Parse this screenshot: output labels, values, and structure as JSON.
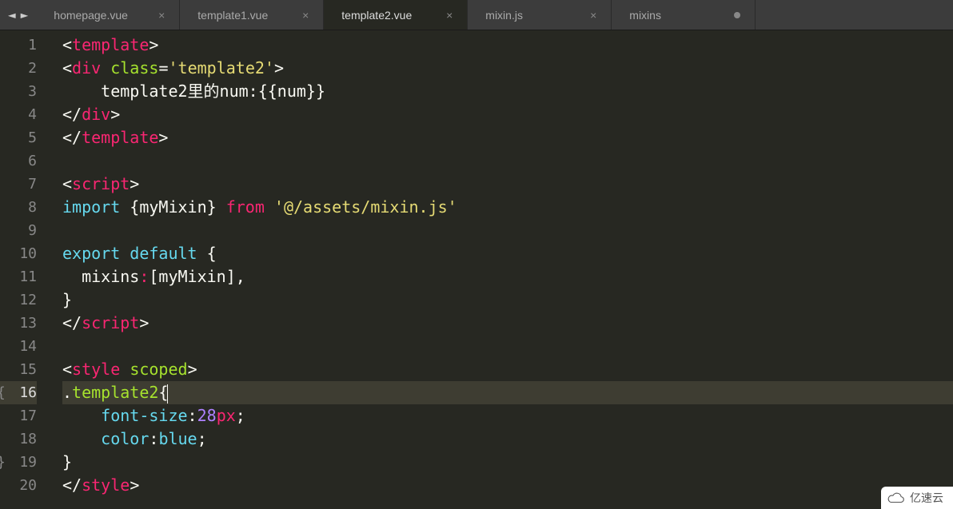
{
  "nav": {
    "back": "◄",
    "forward": "►"
  },
  "tabs": [
    {
      "label": "homepage.vue",
      "active": false,
      "closable": true
    },
    {
      "label": "template1.vue",
      "active": false,
      "closable": true
    },
    {
      "label": "template2.vue",
      "active": true,
      "closable": true
    },
    {
      "label": "mixin.js",
      "active": false,
      "closable": true
    },
    {
      "label": "mixins",
      "active": false,
      "closable": false,
      "dirty": true
    }
  ],
  "active_line": 16,
  "fold_open": 16,
  "fold_close": 19,
  "code": [
    {
      "n": 1,
      "t": [
        [
          "<",
          "c-white"
        ],
        [
          "template",
          "c-red"
        ],
        [
          ">",
          "c-white"
        ]
      ]
    },
    {
      "n": 2,
      "t": [
        [
          "<",
          "c-white"
        ],
        [
          "div",
          "c-red"
        ],
        [
          " ",
          "c-white"
        ],
        [
          "class",
          "c-green"
        ],
        [
          "=",
          "c-white"
        ],
        [
          "'template2'",
          "c-yellow"
        ],
        [
          ">",
          "c-white"
        ]
      ]
    },
    {
      "n": 3,
      "t": [
        [
          "    template2里的num:{{num}}",
          "c-white"
        ]
      ]
    },
    {
      "n": 4,
      "t": [
        [
          "</",
          "c-white"
        ],
        [
          "div",
          "c-red"
        ],
        [
          ">",
          "c-white"
        ]
      ]
    },
    {
      "n": 5,
      "t": [
        [
          "</",
          "c-white"
        ],
        [
          "template",
          "c-red"
        ],
        [
          ">",
          "c-white"
        ]
      ]
    },
    {
      "n": 6,
      "t": []
    },
    {
      "n": 7,
      "t": [
        [
          "<",
          "c-white"
        ],
        [
          "script",
          "c-red"
        ],
        [
          ">",
          "c-white"
        ]
      ]
    },
    {
      "n": 8,
      "t": [
        [
          "import",
          "c-blue"
        ],
        [
          " {myMixin} ",
          "c-white"
        ],
        [
          "from",
          "c-red"
        ],
        [
          " ",
          "c-white"
        ],
        [
          "'@/assets/mixin.js'",
          "c-yellow"
        ]
      ]
    },
    {
      "n": 9,
      "t": []
    },
    {
      "n": 10,
      "t": [
        [
          "export",
          "c-blue"
        ],
        [
          " ",
          "c-white"
        ],
        [
          "default",
          "c-blue"
        ],
        [
          " {",
          "c-white"
        ]
      ]
    },
    {
      "n": 11,
      "t": [
        [
          "  mixins",
          "c-white"
        ],
        [
          ":",
          "c-red"
        ],
        [
          "[myMixin],",
          "c-white"
        ]
      ]
    },
    {
      "n": 12,
      "t": [
        [
          "}",
          "c-white"
        ]
      ]
    },
    {
      "n": 13,
      "t": [
        [
          "</",
          "c-white"
        ],
        [
          "script",
          "c-red"
        ],
        [
          ">",
          "c-white"
        ]
      ]
    },
    {
      "n": 14,
      "t": []
    },
    {
      "n": 15,
      "t": [
        [
          "<",
          "c-white"
        ],
        [
          "style",
          "c-red"
        ],
        [
          " ",
          "c-white"
        ],
        [
          "scoped",
          "c-green"
        ],
        [
          ">",
          "c-white"
        ]
      ]
    },
    {
      "n": 16,
      "t": [
        [
          ".",
          "c-white"
        ],
        [
          "template2",
          "c-green"
        ],
        [
          "{",
          "c-white"
        ]
      ],
      "cursor": true
    },
    {
      "n": 17,
      "t": [
        [
          "    ",
          "c-white"
        ],
        [
          "font-size",
          "c-blue"
        ],
        [
          ":",
          "c-white"
        ],
        [
          "28",
          "c-purple"
        ],
        [
          "px",
          "c-red"
        ],
        [
          ";",
          "c-white"
        ]
      ]
    },
    {
      "n": 18,
      "t": [
        [
          "    ",
          "c-white"
        ],
        [
          "color",
          "c-blue"
        ],
        [
          ":",
          "c-white"
        ],
        [
          "blue",
          "c-blue"
        ],
        [
          ";",
          "c-white"
        ]
      ]
    },
    {
      "n": 19,
      "t": [
        [
          "}",
          "c-white"
        ]
      ]
    },
    {
      "n": 20,
      "t": [
        [
          "</",
          "c-white"
        ],
        [
          "style",
          "c-red"
        ],
        [
          ">",
          "c-white"
        ]
      ]
    }
  ],
  "watermark": "亿速云"
}
